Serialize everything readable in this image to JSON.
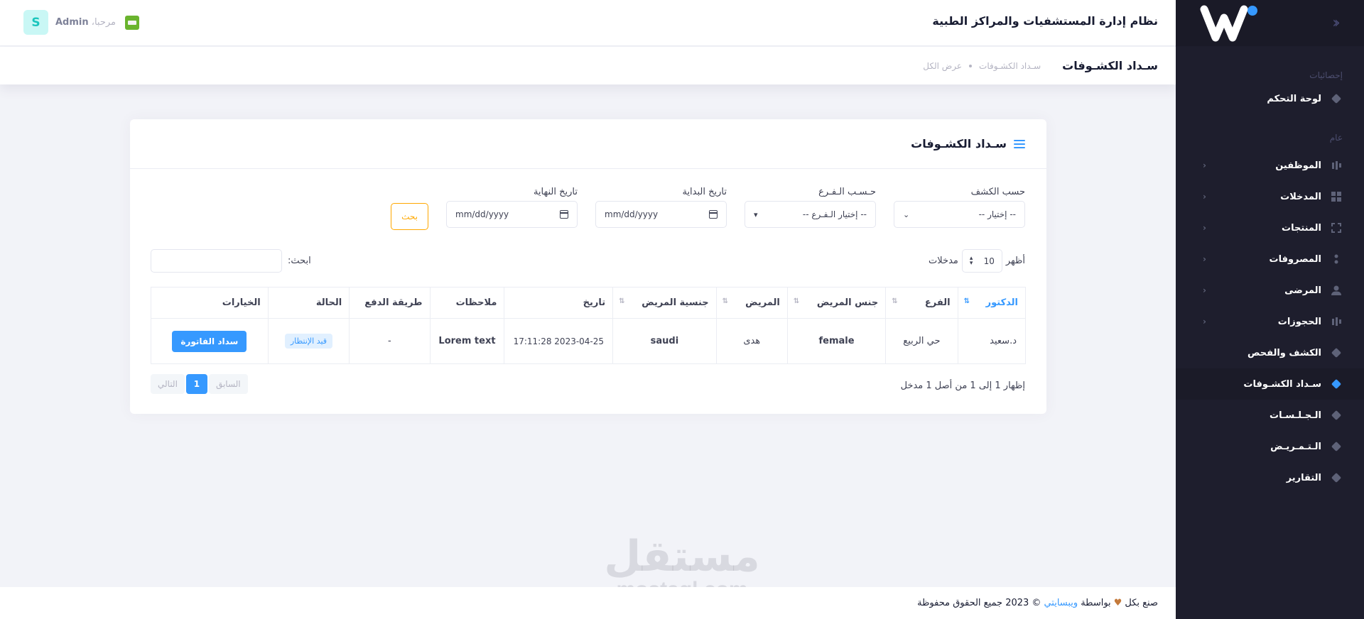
{
  "header": {
    "app_title": "نظام إدارة المستشفيات والمراكز الطبية",
    "greeting": "مرحبا،",
    "user_name": "Admin",
    "avatar_letter": "S"
  },
  "subheader": {
    "title": "سـداد الكشـوفات",
    "breadcrumb": [
      "سـداد الكشـوفات",
      "عرض الكل"
    ]
  },
  "sidebar": {
    "sections": [
      {
        "title": "إحصائيات",
        "items": [
          {
            "label": "لوحة التحكم",
            "icon": "diamond-icon",
            "arrow": false
          }
        ]
      },
      {
        "title": "عام",
        "items": [
          {
            "label": "الموظفين",
            "icon": "bar-chart-icon",
            "arrow": true
          },
          {
            "label": "المدخلات",
            "icon": "grid-icon",
            "arrow": true
          },
          {
            "label": "المنتجات",
            "icon": "expand-icon",
            "arrow": true
          },
          {
            "label": "المصروفات",
            "icon": "nodes-icon",
            "arrow": true
          },
          {
            "label": "المرضى",
            "icon": "user-icon",
            "arrow": true
          },
          {
            "label": "الحجوزات",
            "icon": "bar-chart-icon",
            "arrow": true
          },
          {
            "label": "الكشف والفحص",
            "icon": "diamond-icon",
            "arrow": false
          },
          {
            "label": "سـداد الكشـوفات",
            "icon": "diamond-icon",
            "arrow": false,
            "active": true
          },
          {
            "label": "الـجـلـسـات",
            "icon": "diamond-icon",
            "arrow": false
          },
          {
            "label": "الـتـمـريـض",
            "icon": "diamond-icon",
            "arrow": false
          },
          {
            "label": "التقارير",
            "icon": "diamond-icon",
            "arrow": false
          }
        ]
      }
    ]
  },
  "card": {
    "title": "سـداد الكشـوفات",
    "filters": {
      "by_exam_label": "حسب الكشف",
      "by_exam_value": "-- إختيار --",
      "by_branch_label": "حـسـب الـفـرع",
      "by_branch_value": "-- إختيار الـفـرع --",
      "start_date_label": "تاريخ البداية",
      "start_date_value": "mm/dd/yyyy",
      "end_date_label": "تاريخ النهاية",
      "end_date_value": "mm/dd/yyyy",
      "search_button": "بحث"
    },
    "length": {
      "show": "أظهر",
      "value": "10",
      "entries": "مدخلات"
    },
    "search_label": "ابحث:",
    "table": {
      "columns": [
        "الدكتور",
        "الفرع",
        "جنس المريض",
        "المريض",
        "جنسية المريض",
        "تاريخ",
        "ملاحظات",
        "طريقة الدفع",
        "الحالة",
        "الخيارات"
      ],
      "rows": [
        {
          "doctor": "د.سعيد",
          "branch": "حي الربيع",
          "gender": "female",
          "patient": "هدى",
          "nationality": "saudi",
          "date": "2023-04-25 17:11:28",
          "notes": "Lorem text",
          "payment": "-",
          "status": "قيد الإنتظار",
          "action": "سداد الفاتورة"
        }
      ]
    },
    "info": "إظهار 1 إلى 1 من أصل 1 مدخل",
    "pagination": {
      "prev": "السابق",
      "current": "1",
      "next": "التالي"
    }
  },
  "footer": {
    "prefix": "صنع بكل",
    "by": "بواسطة",
    "brand": "ويبسايتي",
    "copyright": "© 2023 جميع الحقوق محفوظة"
  },
  "watermark": {
    "arabic": "مستقل",
    "latin": "mostaql.com"
  },
  "colors": {
    "primary": "#3699ff",
    "warning": "#ffa800",
    "sidebar": "#1e1e2d",
    "success_flag": "#6ab42e"
  }
}
